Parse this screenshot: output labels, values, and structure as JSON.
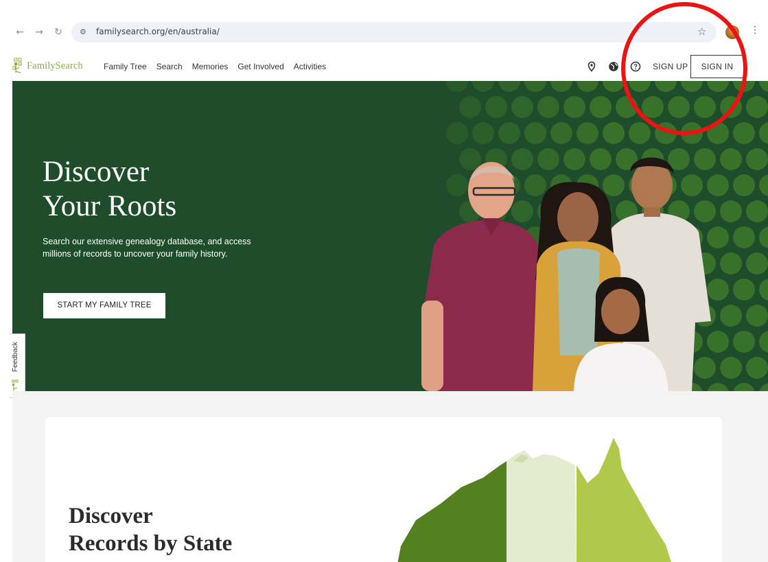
{
  "browser": {
    "url": "familysearch.org/en/australia/",
    "back_icon": "back-arrow-icon",
    "forward_icon": "forward-arrow-icon",
    "reload_icon": "reload-icon"
  },
  "header": {
    "logo_text": "FamilySearch",
    "nav": [
      "Family Tree",
      "Search",
      "Memories",
      "Get Involved",
      "Activities"
    ],
    "icons": [
      "location-pin-icon",
      "globe-icon",
      "help-icon"
    ],
    "signup_label": "SIGN UP",
    "signin_label": "SIGN IN"
  },
  "hero": {
    "title_line1": "Discover",
    "title_line2": "Your Roots",
    "description": "Search our extensive genealogy database, and access millions of records to uncover your family history.",
    "cta_label": "START MY FAMILY TREE"
  },
  "feedback": {
    "label": "Feedback"
  },
  "records_section": {
    "title_line1": "Discover",
    "title_line2": "Records by State"
  },
  "colors": {
    "hero_bg": "#1f4d2b",
    "brand_green": "#87b33c",
    "annotation_red": "#ee1313"
  }
}
